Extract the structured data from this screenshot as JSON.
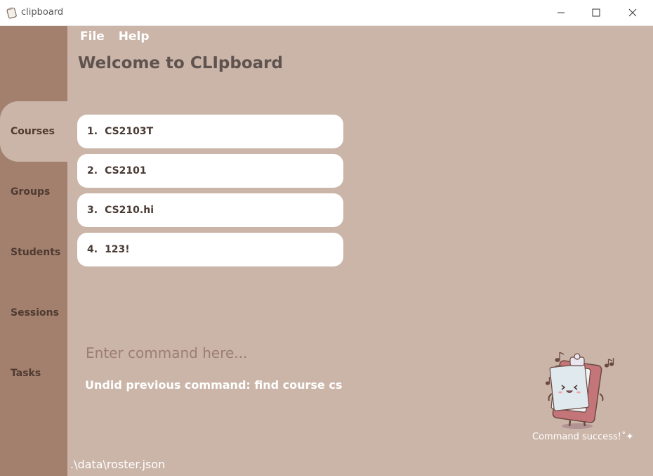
{
  "window": {
    "title": "clipboard",
    "icons": {
      "app": "clipboard-icon",
      "minimize": "minimize-icon",
      "maximize": "maximize-icon",
      "close": "close-icon"
    }
  },
  "menu": {
    "file": "File",
    "help": "Help"
  },
  "header": {
    "welcome": "Welcome to CLIpboard"
  },
  "sidebar": {
    "items": [
      {
        "label": "Courses",
        "active": true
      },
      {
        "label": "Groups"
      },
      {
        "label": "Students"
      },
      {
        "label": "Sessions"
      },
      {
        "label": "Tasks"
      }
    ]
  },
  "courses": [
    {
      "index": "1.",
      "code": "CS2103T"
    },
    {
      "index": "2.",
      "code": "CS2101"
    },
    {
      "index": "3.",
      "code": "CS210.hi"
    },
    {
      "index": "4.",
      "code": "123!"
    }
  ],
  "command": {
    "placeholder": "Enter command here...",
    "result": "Undid previous command: find course cs"
  },
  "mascot": {
    "caption": "Command success!˚✦",
    "icon": "clipboard-mascot-icon"
  },
  "status": {
    "path": ".\\data\\roster.json"
  },
  "colors": {
    "background": "#cbb5a8",
    "sidebar": "#a2806d",
    "card": "#ffffff",
    "text_dark": "#4f3a31",
    "welcome": "#5f5350"
  }
}
